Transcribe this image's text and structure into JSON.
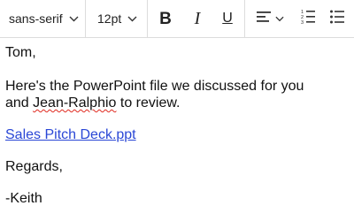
{
  "toolbar": {
    "font_family": "sans-serif",
    "font_size": "12pt",
    "bold_icon": "B",
    "italic_icon": "I",
    "underline_icon": "U",
    "icons": [
      "chevron-down-icon",
      "bold-icon",
      "italic-icon",
      "underline-icon",
      "align-left-icon",
      "numbered-list-icon",
      "bulleted-list-icon"
    ]
  },
  "body": {
    "greeting": "Tom,",
    "line1": "Here's the PowerPoint file we discussed for you",
    "line2_prefix": "and ",
    "misspelled": "Jean-Ralphio",
    "line2_suffix": " to review.",
    "attachment_link": "Sales Pitch Deck.ppt",
    "closing": "Regards,",
    "signature": "-Keith"
  },
  "colors": {
    "link": "#2a47d6",
    "spellcheck": "#e0281e",
    "divider": "#dcdcdc"
  }
}
